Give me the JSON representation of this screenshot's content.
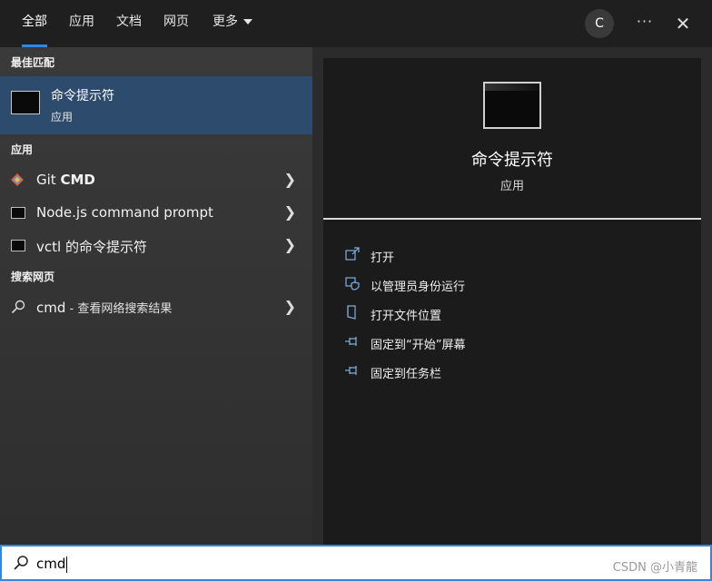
{
  "tabs": [
    {
      "label": "全部",
      "active": true
    },
    {
      "label": "应用"
    },
    {
      "label": "文档"
    },
    {
      "label": "网页"
    },
    {
      "label": "更多"
    }
  ],
  "topbar": {
    "avatar": "C",
    "more": "···",
    "close": "✕"
  },
  "left": {
    "best_match_header": "最佳匹配",
    "best_match": {
      "title": "命令提示符",
      "subtitle": "应用",
      "icon": "terminal-icon"
    },
    "apps_header": "应用",
    "apps": [
      {
        "name_pre": "Git ",
        "name_bold": "CMD",
        "icon": "git-icon"
      },
      {
        "name": "Node.js command prompt",
        "icon": "terminal-icon"
      },
      {
        "name": "vctl 的命令提示符",
        "icon": "terminal-icon"
      }
    ],
    "web_header": "搜索网页",
    "web": {
      "query": "cmd",
      "suffix": " - 查看网络搜索结果",
      "icon": "search-icon"
    }
  },
  "right": {
    "title": "命令提示符",
    "subtitle": "应用",
    "actions": [
      {
        "label": "打开",
        "icon": "open-icon"
      },
      {
        "label": "以管理员身份运行",
        "icon": "shield-icon"
      },
      {
        "label": "打开文件位置",
        "icon": "folder-icon"
      },
      {
        "label": "固定到“开始”屏幕",
        "icon": "pin-icon"
      },
      {
        "label": "固定到任务栏",
        "icon": "pin-icon"
      }
    ]
  },
  "search": {
    "value": "cmd",
    "icon": "search-icon"
  },
  "watermark": "CSDN @小青龍",
  "colors": {
    "accent": "#2d8ae0",
    "selection": "#2c4b6d"
  }
}
